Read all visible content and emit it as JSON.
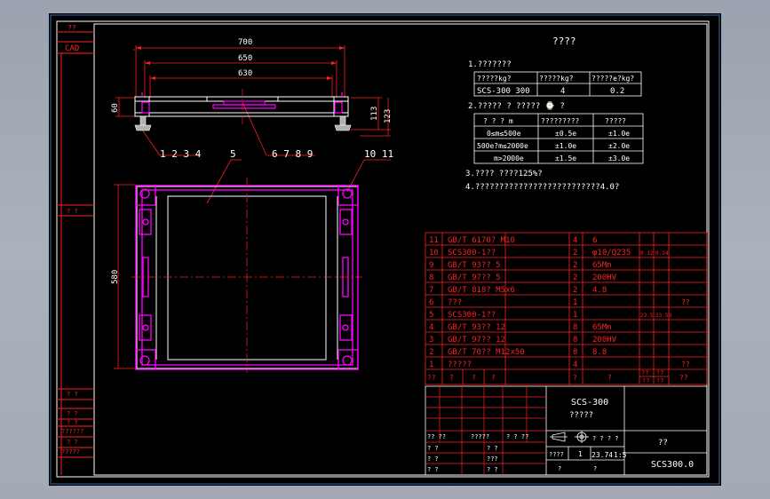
{
  "title_block": {
    "corner_labels": [
      "??",
      "CAD"
    ],
    "side_labels": [
      "? ?",
      "? ?",
      "? ?",
      "? ?",
      "? ?",
      "??????",
      "?????"
    ]
  },
  "top_view": {
    "dim_700": "700",
    "dim_650": "650",
    "dim_630": "630",
    "dim_60": "60",
    "dim_113": "113",
    "dim_123": "123",
    "callout_1234": "1 2 3 4",
    "callout_5": "5",
    "callout_6789": "6 7 8 9",
    "callout_1011": "10 11",
    "dim_580": "580"
  },
  "tech_requirements": {
    "heading": "????",
    "item1": "1.???????",
    "table1": [
      [
        "?????kg?",
        "?????kg?",
        "?????e?kg?"
      ],
      [
        "SCS-300 300",
        "4",
        "0.2"
      ]
    ],
    "item2": "2.????? ? ????? ⌚ ?",
    "table2": [
      [
        "?  ?  ? m",
        "?????????",
        "?????"
      ],
      [
        "0≤m≤500e",
        "±0.5e",
        "±1.0e"
      ],
      [
        "500e?m≤2000e",
        "±1.0e",
        "±2.0e"
      ],
      [
        "m>2000e",
        "±1.5e",
        "±3.0e"
      ]
    ],
    "item3": "3.????  ????125%?",
    "item4": "4.??????????????????????????4.0?"
  },
  "bom": {
    "rows": [
      {
        "no": "11",
        "code": "GB/T 6170? M10",
        "qty": "4",
        "material": "6",
        "w1": "",
        "w2": "",
        "note": ""
      },
      {
        "no": "10",
        "code": "SCS300-1??",
        "qty": "2",
        "material": "φ10/Q235",
        "w1": "0.12",
        "w2": "0.24",
        "note": ""
      },
      {
        "no": "9",
        "code": "GB/T 93?? 5",
        "qty": "2",
        "material": "65Mn",
        "w1": "",
        "w2": "",
        "note": ""
      },
      {
        "no": "8",
        "code": "GB/T 97?? 5",
        "qty": "2",
        "material": "200HV",
        "w1": "",
        "w2": "",
        "note": ""
      },
      {
        "no": "7",
        "code": "GB/T 818? M5x6",
        "qty": "2",
        "material": "4.8",
        "w1": "",
        "w2": "",
        "note": ""
      },
      {
        "no": "6",
        "code": "???",
        "qty": "1",
        "material": "",
        "w1": "",
        "w2": "",
        "note": "??"
      },
      {
        "no": "5",
        "code": "SCS300-1??",
        "qty": "1",
        "material": "",
        "w1": "23.5",
        "w2": "23.59",
        "note": ""
      },
      {
        "no": "4",
        "code": "GB/T 93?? 12",
        "qty": "8",
        "material": "65Mn",
        "w1": "",
        "w2": "",
        "note": ""
      },
      {
        "no": "3",
        "code": "GB/T 97?? 12",
        "qty": "8",
        "material": "200HV",
        "w1": "",
        "w2": "",
        "note": ""
      },
      {
        "no": "2",
        "code": "GB/T 70?? M12x50",
        "qty": "8",
        "material": "8.8",
        "w1": "",
        "w2": "",
        "note": ""
      },
      {
        "no": "1",
        "code": "?????",
        "qty": "4",
        "material": "",
        "w1": "",
        "w2": "",
        "note": "??"
      }
    ],
    "header": {
      "no": "??",
      "c1": "?",
      "c2": "?",
      "c3": "?",
      "qty": "?",
      "material": "?",
      "w1": "??",
      "w2": "??",
      "note": "??",
      "w_sub1": "??",
      "w_sub2": "??"
    }
  },
  "title_area": {
    "product": "SCS-300",
    "product_sub": "?????",
    "stage_row": [
      "?? ??",
      "?????",
      "? ? ??"
    ],
    "weight_label": "? ? ? ?",
    "weight_value": "23.74",
    "scale": "1:5",
    "sheet": "? ?",
    "right_label": "??",
    "drawing_no": "SCS300.0",
    "left_rows": [
      [
        "?  ?",
        "",
        "? ?",
        ""
      ],
      [
        "?  ?",
        "",
        "???",
        ""
      ],
      [
        "?  ?",
        "",
        "? ?",
        ""
      ]
    ],
    "page_label": "????",
    "page_num": "1",
    "bottom_q": [
      "?",
      "?"
    ]
  },
  "colors": {
    "background": "#000000",
    "frame": "#ffffff",
    "red": "#ff2020",
    "magenta": "#ff00ff",
    "white_text": "#ffffff"
  }
}
